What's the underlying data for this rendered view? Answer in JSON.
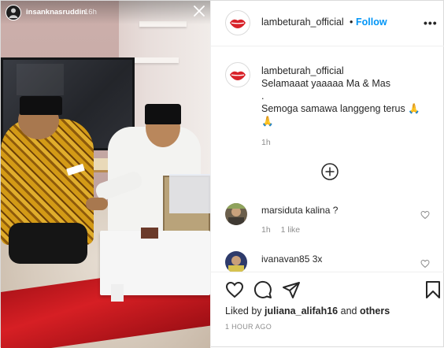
{
  "story": {
    "username": "insanknasruddin",
    "time_ago": "16h"
  },
  "post": {
    "header": {
      "username": "lambeturah_official",
      "separator": "•",
      "follow_label": "Follow",
      "more_label": "•••"
    },
    "caption": {
      "username": "lambeturah_official",
      "lines": [
        "Selamaaat yaaaaa Ma & Mas",
        ".",
        "Semoga samawa langgeng terus 🙏",
        "🙏"
      ],
      "time": "1h"
    },
    "comments": [
      {
        "username": "marsiduta",
        "text": "kalina ?",
        "time": "1h",
        "likes": "1 like"
      },
      {
        "username": "ivanavan85",
        "text": "3x"
      }
    ],
    "actions": {
      "liked_by_prefix": "Liked by ",
      "liked_by_user": "juliana_alifah16",
      "liked_by_and": " and ",
      "liked_by_others": "others",
      "date": "1 HOUR AGO"
    }
  },
  "colors": {
    "accent_blue": "#0095f6",
    "logo_red": "#d8232a",
    "muted_text": "#8e8e8e"
  },
  "icons": {
    "story_close": "close-icon",
    "load_more": "plus-circle-icon",
    "like": "heart-icon",
    "comment": "comment-icon",
    "share": "paper-plane-icon",
    "save": "bookmark-icon"
  }
}
